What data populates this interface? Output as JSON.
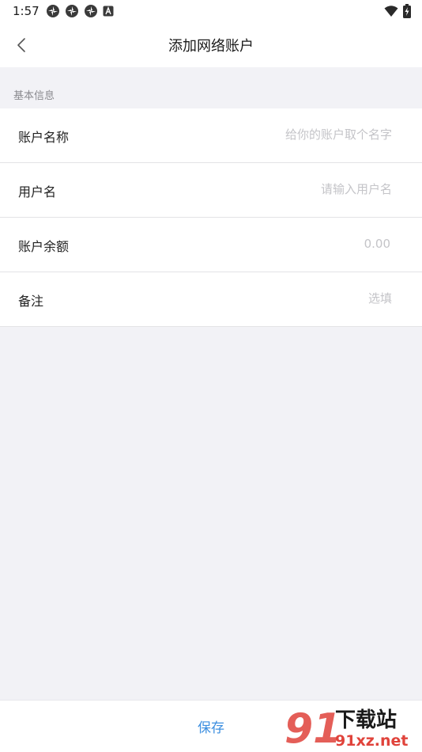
{
  "status_bar": {
    "time": "1:57",
    "left_icons": [
      "app-notification-icon",
      "app-notification-icon",
      "app-notification-icon",
      "keyboard-a-icon"
    ],
    "right_icons": [
      "wifi-icon",
      "battery-charging-icon"
    ]
  },
  "header": {
    "title": "添加网络账户",
    "back_icon": "chevron-left-icon"
  },
  "section": {
    "title": "基本信息"
  },
  "form": {
    "fields": [
      {
        "label": "账户名称",
        "value": "",
        "placeholder": "给你的账户取个名字"
      },
      {
        "label": "用户名",
        "value": "",
        "placeholder": "请输入用户名"
      },
      {
        "label": "账户余额",
        "value": "",
        "placeholder": "0.00"
      },
      {
        "label": "备注",
        "value": "",
        "placeholder": "选填"
      }
    ]
  },
  "bottom": {
    "save_label": "保存"
  },
  "watermark": {
    "logo_text": "91",
    "site_name": "下载站",
    "url": "91xz.net"
  },
  "colors": {
    "accent": "#3d8fe0",
    "background": "#f2f2f6",
    "watermark_red": "#e0433b"
  }
}
